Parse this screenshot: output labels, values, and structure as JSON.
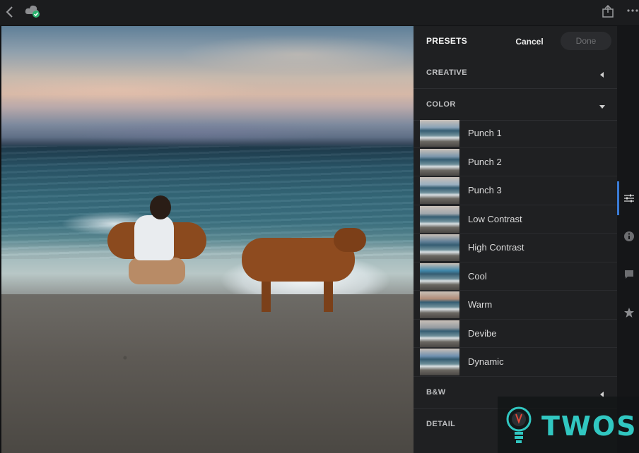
{
  "panel": {
    "title": "PRESETS",
    "cancel_label": "Cancel",
    "done_label": "Done",
    "sections": {
      "creative": "CREATIVE",
      "color": "COLOR",
      "bw": "B&W",
      "detail": "DETAIL"
    },
    "presets": [
      {
        "name": "Punch 1",
        "tint": "#8aa3b7"
      },
      {
        "name": "Punch 2",
        "tint": "#7d98ad"
      },
      {
        "name": "Punch 3",
        "tint": "#9bb1c1"
      },
      {
        "name": "Low Contrast",
        "tint": "#a2a8ae"
      },
      {
        "name": "High Contrast",
        "tint": "#5f7d95"
      },
      {
        "name": "Cool",
        "tint": "#3f86a8"
      },
      {
        "name": "Warm",
        "tint": "#b08c78"
      },
      {
        "name": "Devibe",
        "tint": "#939aa0"
      },
      {
        "name": "Dynamic",
        "tint": "#6f90b0"
      }
    ]
  },
  "watermark": {
    "brand": "TWOS"
  },
  "colors": {
    "accent": "#3a7bd5",
    "brand": "#31c7c1",
    "sync_ok": "#2ab36f"
  },
  "icons": [
    "back-icon",
    "cloud-sync-icon",
    "share-icon",
    "more-icon",
    "sliders-icon",
    "info-icon",
    "comment-icon",
    "star-icon",
    "chevron-left-icon",
    "chevron-down-icon",
    "lightbulb-icon"
  ]
}
